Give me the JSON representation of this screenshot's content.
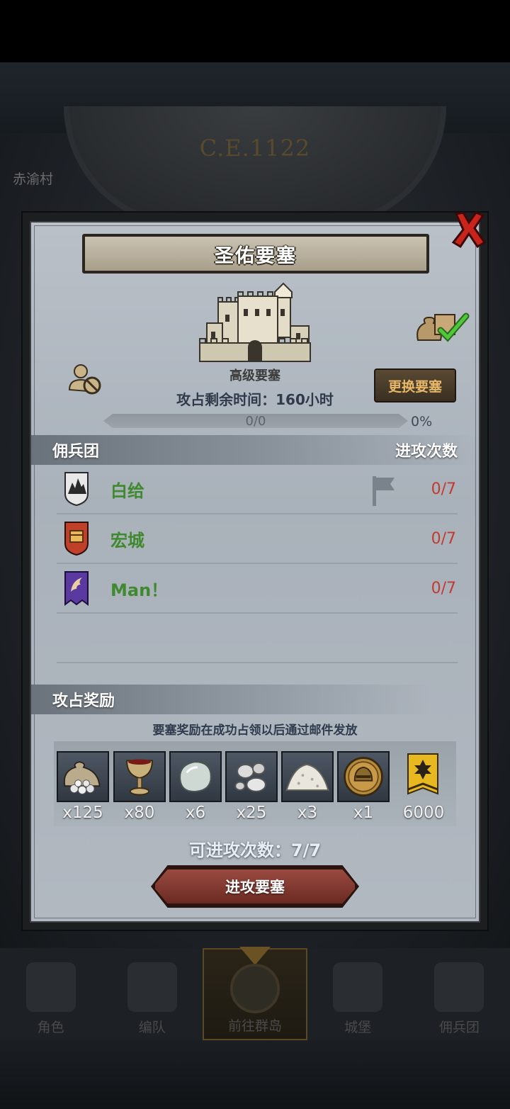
{
  "background": {
    "year_label": "C.E.1122",
    "village_label": "赤渝村"
  },
  "dialog": {
    "title": "圣佑要塞",
    "fortress_grade": "高级要塞",
    "change_button": "更换要塞",
    "time_remaining": "攻占剩余时间：160小时",
    "progress": {
      "text": "0/0",
      "percent_label": "0%",
      "fraction": 0
    },
    "mercenary_section": {
      "title": "佣兵团",
      "attacks_header": "进攻次数"
    },
    "mercenaries": [
      {
        "name": "白给",
        "attempts": "0/7",
        "emblem": "mountain-shield-icon",
        "color": "#e8e8e8"
      },
      {
        "name": "宏城",
        "attempts": "0/7",
        "emblem": "chest-shield-icon",
        "color": "#c0402a"
      },
      {
        "name": "Man！",
        "attempts": "0/7",
        "emblem": "dragon-banner-icon",
        "color": "#5a3aa0"
      }
    ],
    "reward_section": {
      "title": "攻占奖励",
      "note": "要塞奖励在成功占领以后通过邮件发放"
    },
    "rewards": [
      {
        "icon": "silver-sack-icon",
        "qty": "x125"
      },
      {
        "icon": "goblet-icon",
        "qty": "x80"
      },
      {
        "icon": "moonstone-icon",
        "qty": "x6"
      },
      {
        "icon": "silver-ore-icon",
        "qty": "x25"
      },
      {
        "icon": "salt-pile-icon",
        "qty": "x3"
      },
      {
        "icon": "knight-helmet-icon",
        "qty": "x1"
      },
      {
        "icon": "honor-banner-icon",
        "qty": "6000"
      }
    ],
    "attacks_available": "可进攻次数：7/7",
    "attack_button": "进攻要塞"
  },
  "bottom_nav": {
    "items": [
      {
        "label": "角色",
        "icon": "knight-icon"
      },
      {
        "label": "编队",
        "icon": "helmet-icon"
      },
      {
        "label": "前往群岛",
        "icon": "globe-icon",
        "active": true
      },
      {
        "label": "城堡",
        "icon": "castle-icon"
      },
      {
        "label": "佣兵团",
        "icon": "ship-icon"
      }
    ]
  }
}
